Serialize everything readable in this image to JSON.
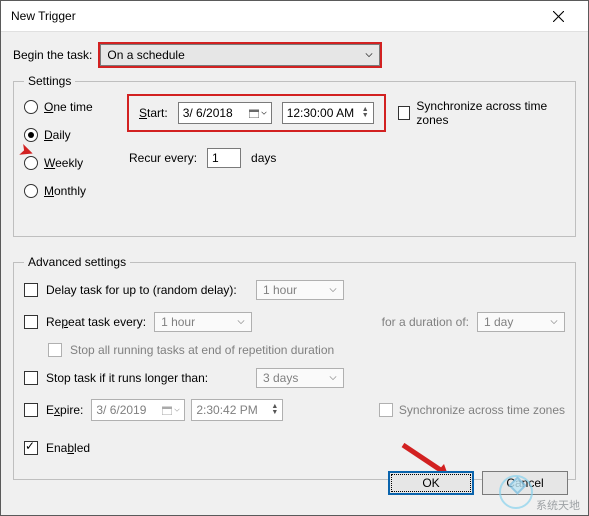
{
  "window": {
    "title": "New Trigger"
  },
  "begin": {
    "label": "Begin the task:",
    "value": "On a schedule"
  },
  "settings": {
    "legend": "Settings",
    "radios": [
      {
        "accel": "O",
        "rest": "ne time"
      },
      {
        "accel": "D",
        "rest": "aily"
      },
      {
        "accel": "W",
        "rest": "eekly"
      },
      {
        "accel": "M",
        "rest": "onthly"
      }
    ],
    "start": {
      "label_accel": "S",
      "label_rest": "tart:",
      "date": "3/ 6/2018",
      "time": "12:30:00 AM"
    },
    "sync_label": "Synchronize across time zones",
    "recur": {
      "label": "Recur every:",
      "value": "1",
      "unit": "days"
    }
  },
  "advanced": {
    "legend": "Advanced settings",
    "delay": {
      "label": "Delay task for up to (random delay):",
      "value": "1 hour"
    },
    "repeat": {
      "label_pre": "Re",
      "label_accel": "p",
      "label_post": "eat task every:",
      "interval": "1 hour",
      "duration_label": "for a duration of:",
      "duration": "1 day"
    },
    "stop_at_end": "Stop all running tasks at end of repetition duration",
    "stop_longer": {
      "label": "Stop task if it runs longer than:",
      "value": "3 days"
    },
    "expire": {
      "label_pre": "E",
      "label_accel": "x",
      "label_post": "pire:",
      "date": "3/ 6/2019",
      "time": "2:30:42 PM",
      "sync_label": "Synchronize across time zones"
    },
    "enabled": {
      "pre": "Ena",
      "accel": "b",
      "post": "led"
    }
  },
  "buttons": {
    "ok": "OK",
    "cancel": "Cancel"
  },
  "watermark": "系统天地"
}
